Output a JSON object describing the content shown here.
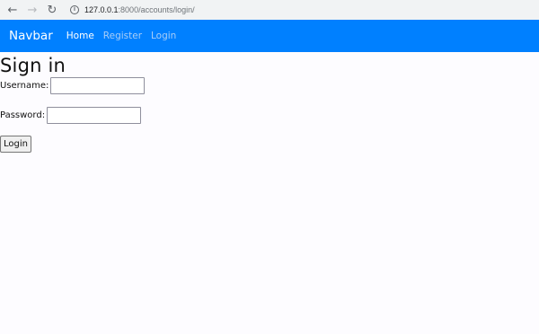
{
  "browser": {
    "back_icon": "←",
    "forward_icon": "→",
    "reload_icon": "↻",
    "info_icon": "i",
    "url_host": "127.0.0.1",
    "url_path": ":8000/accounts/login/"
  },
  "navbar": {
    "brand": "Navbar",
    "links": [
      {
        "label": "Home"
      },
      {
        "label": "Register"
      },
      {
        "label": "Login"
      }
    ],
    "color": "#0080ff"
  },
  "page": {
    "title": "Sign in",
    "username_label": "Username:",
    "username_value": "",
    "password_label": "Password:",
    "password_value": "",
    "login_button": "Login"
  }
}
